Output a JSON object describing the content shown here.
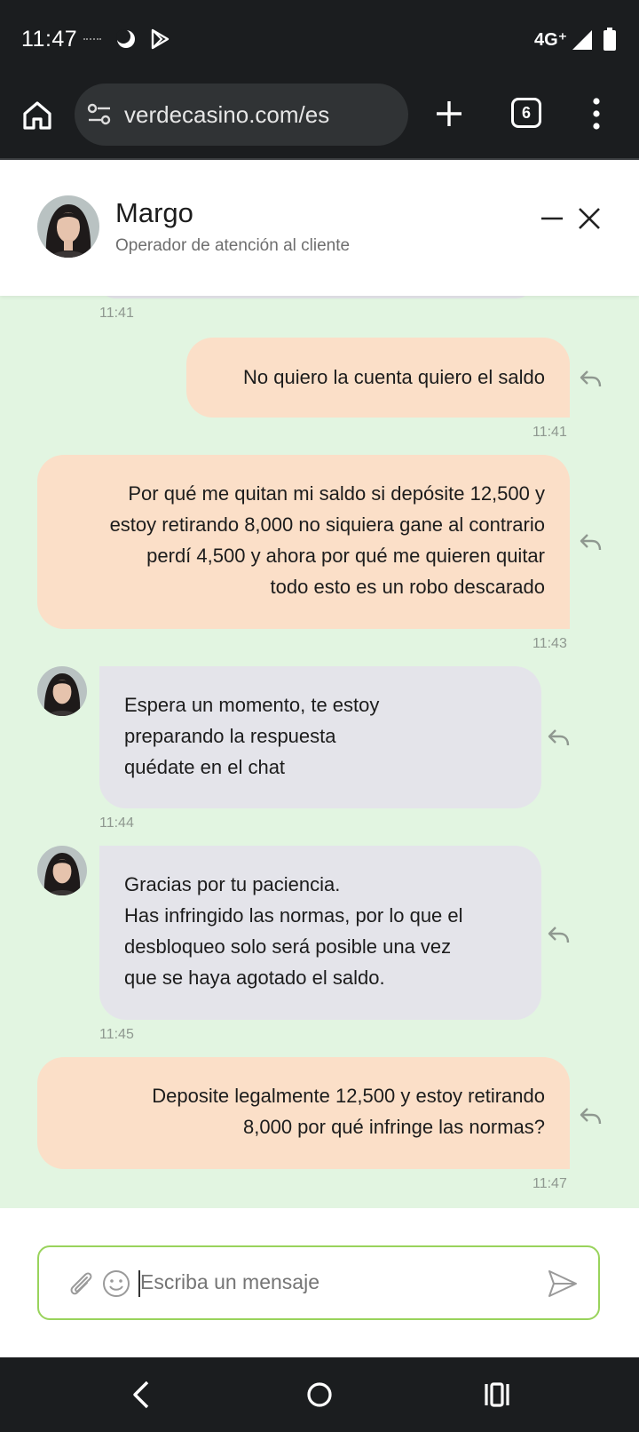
{
  "status_bar": {
    "time": "11:47",
    "network": "4G⁺",
    "icons": [
      "moon-icon",
      "play-store-icon",
      "signal-icon",
      "battery-icon"
    ]
  },
  "browser": {
    "url": "verdecasino.com/es",
    "tab_count": "6",
    "icons": [
      "home-icon",
      "site-settings-icon",
      "new-tab-icon",
      "more-icon"
    ]
  },
  "chat": {
    "agent_name": "Margo",
    "agent_role": "Operador de atención al cliente",
    "messages": [
      {
        "from": "agent",
        "lines": [],
        "time": "11:41"
      },
      {
        "from": "user",
        "lines": [
          "No quiero la cuenta quiero el saldo"
        ],
        "time": "11:41"
      },
      {
        "from": "user",
        "lines": [
          "Por qué me quitan mi saldo si depósite 12,500 y",
          "estoy retirando 8,000 no siquiera gane al contrario",
          "perdí 4,500 y ahora por qué me quieren quitar",
          "todo esto es un robo descarado"
        ],
        "time": "11:43"
      },
      {
        "from": "agent",
        "lines": [
          "Espera un momento, te estoy",
          "preparando la respuesta",
          "quédate en el chat"
        ],
        "time": "11:44"
      },
      {
        "from": "agent",
        "lines": [
          "Gracias por tu paciencia.",
          "Has infringido las normas, por lo que el",
          "desbloqueo solo será posible una vez",
          "que se haya agotado el saldo."
        ],
        "time": "11:45"
      },
      {
        "from": "user",
        "lines": [
          "Deposite legalmente 12,500 y estoy retirando",
          "8,000 por qué infringe las normas?"
        ],
        "time": "11:47"
      }
    ]
  },
  "composer": {
    "placeholder": "Escriba un mensaje",
    "value": ""
  },
  "colors": {
    "chat_background": "#e2f5e1",
    "user_bubble": "#fbdfc8",
    "agent_bubble": "#e4e4ea",
    "composer_border": "#99d35c",
    "system_bars": "#1b1d1f"
  }
}
